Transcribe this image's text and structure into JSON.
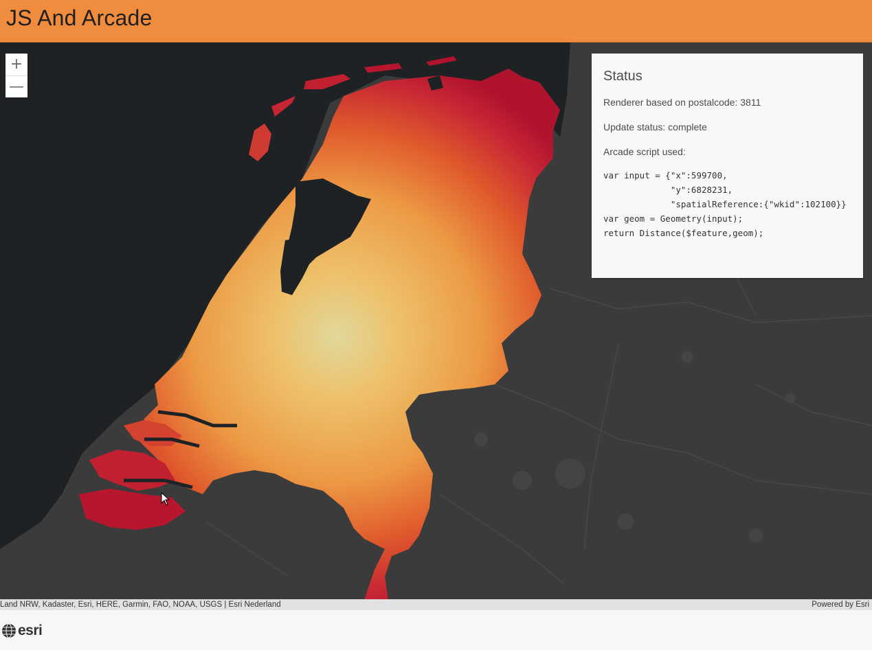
{
  "app": {
    "title": "JS And Arcade"
  },
  "zoom": {
    "in_label": "+",
    "out_label": "—"
  },
  "status": {
    "heading": "Status",
    "renderer": "Renderer based on postalcode: 3811",
    "update": "Update status: complete",
    "script_label": "Arcade script used:",
    "script": "var input = {\"x\":599700,\n             \"y\":6828231,\n             \"spatialReference:{\"wkid\":102100}}\nvar geom = Geometry(input);\nreturn Distance($feature,geom);"
  },
  "attribution": {
    "sources": "Land NRW, Kadaster, Esri, HERE, Garmin, FAO, NOAA, USGS | Esri Nederland",
    "powered_by": "Powered by Esri"
  },
  "footer": {
    "logo_text": "esri"
  },
  "colors": {
    "header": "#f08c3e",
    "sea": "#1f2225",
    "land": "#3b3b3b",
    "near": "#e0d89a",
    "mid": "#ec9a44",
    "far": "#b8152e"
  }
}
